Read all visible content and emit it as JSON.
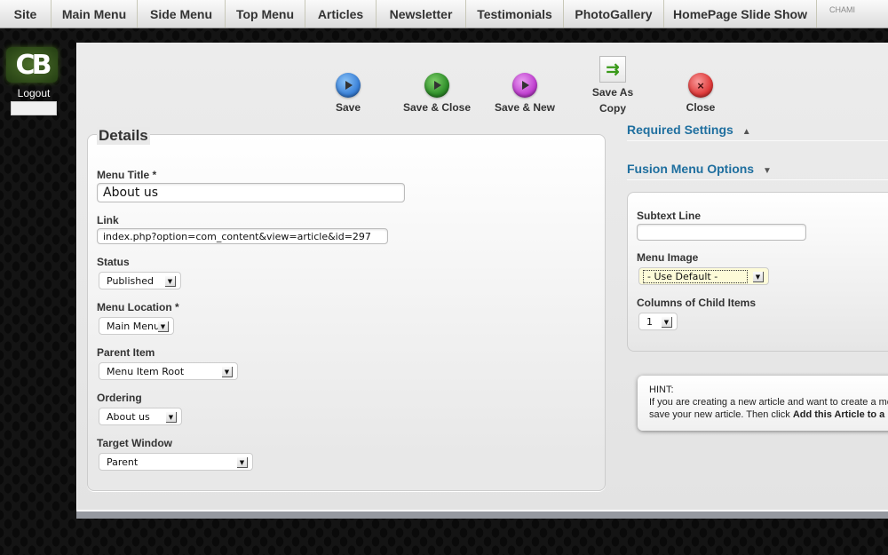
{
  "topnav": {
    "items": [
      "Site",
      "Main Menu",
      "Side Menu",
      "Top Menu",
      "Articles",
      "Newsletter",
      "Testimonials",
      "PhotoGallery",
      "HomePage Slide Show"
    ],
    "brand_text": "CHAMI"
  },
  "sidebar": {
    "logo_text": "CB",
    "logout_label": "Logout"
  },
  "toolbar": {
    "save": "Save",
    "save_close": "Save & Close",
    "save_new": "Save & New",
    "save_copy_line1": "Save As",
    "save_copy_line2": "Copy",
    "close": "Close",
    "colors": {
      "save": "#3b82d9",
      "save_close": "#2f8f2a",
      "save_new": "#c03fd0",
      "close": "#e03a3a"
    }
  },
  "details": {
    "legend": "Details",
    "menu_title_label": "Menu Title *",
    "menu_title_value": "About us",
    "link_label": "Link",
    "link_value": "index.php?option=com_content&view=article&id=297",
    "status_label": "Status",
    "status_value": "Published",
    "menu_location_label": "Menu Location *",
    "menu_location_value": "Main Menu",
    "parent_item_label": "Parent Item",
    "parent_item_value": "Menu Item Root",
    "ordering_label": "Ordering",
    "ordering_value": "About us",
    "target_window_label": "Target Window",
    "target_window_value": "Parent"
  },
  "right": {
    "required_settings": "Required Settings",
    "fusion_menu_options": "Fusion Menu Options",
    "subtext_label": "Subtext Line",
    "subtext_value": "",
    "menu_image_label": "Menu Image",
    "menu_image_value": "- Use Default -",
    "columns_label": "Columns of Child Items",
    "columns_value": "1"
  },
  "hint": {
    "title": "HINT:",
    "line1": "If you are creating a new article and want to create a me",
    "line2_prefix": "save your new article. Then click ",
    "line2_bold": "Add this Article to a"
  },
  "accent_color": "#1f6f9f"
}
